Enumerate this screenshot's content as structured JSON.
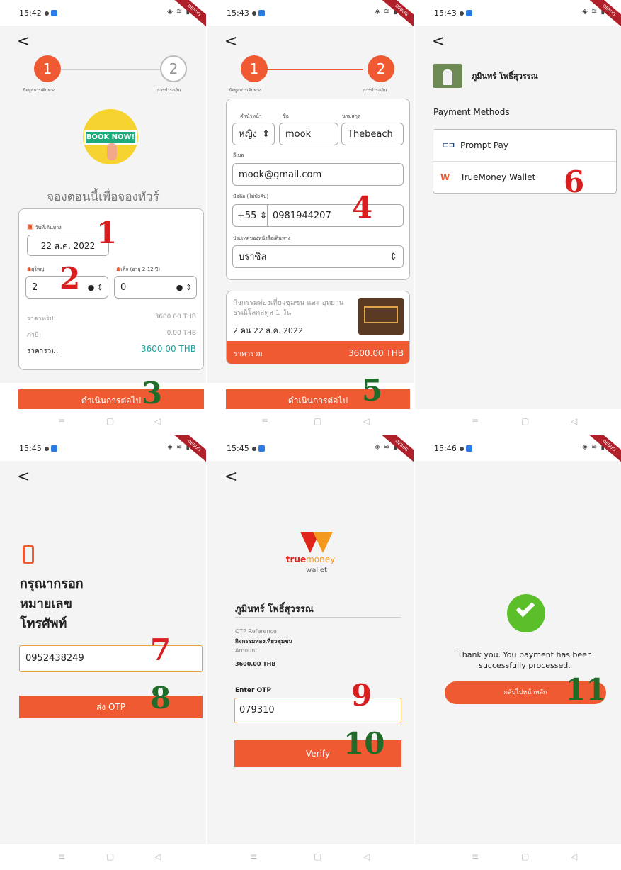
{
  "status": {
    "times": [
      "15:42",
      "15:43",
      "15:43",
      "15:45",
      "15:45",
      "15:46"
    ],
    "debug_label": "DEBUG"
  },
  "nav": {
    "back": "<",
    "menu": "≡",
    "home": "▢",
    "back_tri": "◁"
  },
  "stepper": {
    "one": "1",
    "two": "2",
    "label_one": "ข้อมูลการเดินทาง",
    "label_two": "การชำระเงิน"
  },
  "screen1": {
    "banner": "BOOK NOW!",
    "heading": "จองตอนนี้เพื่อจองทัวร์",
    "date_label": "วันที่เดินทาง",
    "date_value": "22 ส.ค. 2022",
    "adult_label": "ผู้ใหญ่",
    "adult_value": "2",
    "child_label": "เด็ก (อายุ 2-12 ปี)",
    "child_value": "0",
    "price_label": "ราคาทริป:",
    "price_value": "3600.00 THB",
    "tax_label": "ภาษี:",
    "tax_value": "0.00 THB",
    "total_label": "ราคารวม:",
    "total_value": "3600.00 THB",
    "continue": "ดำเนินการต่อไป"
  },
  "screen2": {
    "title_label": "คำนำหน้า",
    "name_label": "ชื่อ",
    "surname_label": "นามสกุล",
    "title_value": "หญิง",
    "name_value": "mook",
    "surname_value": "Thebeach",
    "email_label": "อีเมล",
    "email_value": "mook@gmail.com",
    "phone_label": "มือถือ (ไม่บังคับ)",
    "phone_code": "+55",
    "phone_value": "0981944207",
    "country_label": "ประเทศของหนังสือเดินทาง",
    "country_value": "บราซิล",
    "tour_desc": "กิจกรรมท่องเที่ยวชุมชน และ อุทยานธรณีโลกสตูล 1 วัน",
    "tour_meta": "2 คน 22 ส.ค. 2022",
    "total_label": "ราคารวม",
    "total_value": "3600.00 THB",
    "continue": "ดำเนินการต่อไป"
  },
  "screen3": {
    "user_name": "ภูมินทร์ โพธิ์สุวรรณ",
    "methods_title": "Payment Methods",
    "method_one": "Prompt Pay",
    "method_two": "TrueMoney Wallet"
  },
  "screen4": {
    "prompt": [
      "กรุณากรอก",
      "หมายเลข",
      "โทรศัพท์"
    ],
    "phone_value": "0952438249",
    "send": "ส่ง OTP"
  },
  "screen5": {
    "logo_true": "true",
    "logo_money": "money",
    "logo_wallet": "wallet",
    "user_name": "ภูมินทร์ โพธิ์สุวรรณ",
    "ref_label": "OTP Reference",
    "ref_value": "กิจกรรมท่องเที่ยวชุมชน",
    "amount_label": "Amount",
    "amount_value": "3600.00 THB",
    "otp_label": "Enter OTP",
    "otp_value": "079310",
    "verify": "Verify"
  },
  "screen6": {
    "message": "Thank you. You payment has been successfully processed.",
    "home_button": "กลับไปหน้าหลัก"
  },
  "markers": [
    "1",
    "2",
    "3",
    "4",
    "5",
    "6",
    "7",
    "8",
    "9",
    "10",
    "11"
  ],
  "colors": {
    "accent": "#ef5a32",
    "marker_red": "#d81e1e",
    "marker_green": "#1e6b2a",
    "success": "#5bbf2a"
  }
}
